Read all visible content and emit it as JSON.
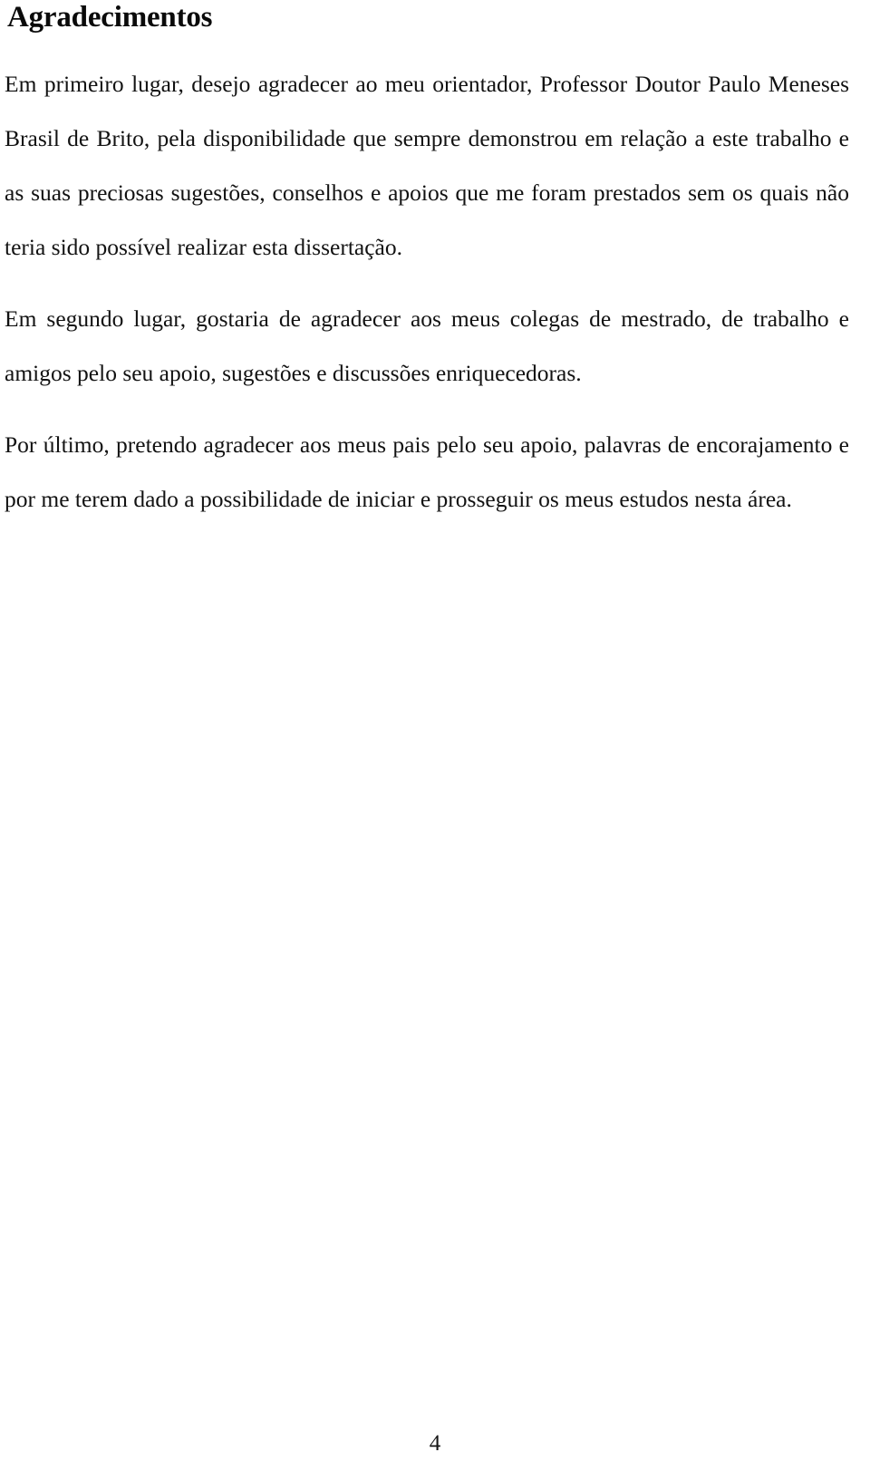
{
  "document": {
    "type": "thesis-acknowledgements-page",
    "language": "pt-PT",
    "heading": "Agradecimentos",
    "paragraphs": [
      "Em primeiro lugar, desejo agradecer ao meu orientador, Professor Doutor Paulo Meneses Brasil de Brito, pela disponibilidade que sempre demonstrou em relação a este trabalho e as suas preciosas sugestões, conselhos e apoios que me foram prestados sem os quais não teria sido possível realizar esta dissertação.",
      "Em segundo lugar, gostaria de agradecer aos meus colegas de mestrado, de trabalho e amigos pelo seu apoio, sugestões e discussões enriquecedoras.",
      "Por último, pretendo agradecer aos meus pais pelo seu apoio, palavras de encorajamento e por me terem dado a possibilidade de iniciar e prosseguir os meus estudos nesta área."
    ],
    "page_number": "4"
  }
}
